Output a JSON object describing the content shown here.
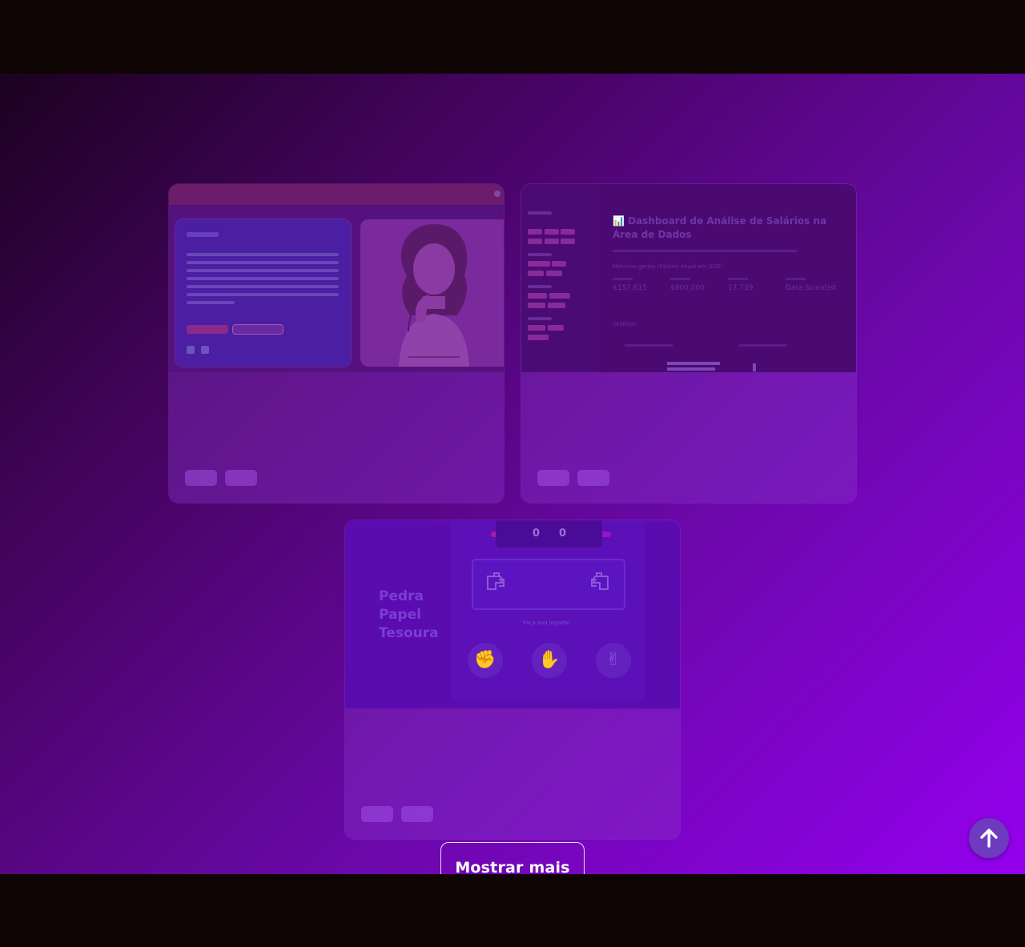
{
  "projects": [
    {
      "id_hint": "portfolio",
      "thumb_colors": {
        "accent": "#8a2a8a"
      }
    },
    {
      "id_hint": "dashboard",
      "thumb_title": "📊 Dashboard de Análise de Salários na Área de Dados",
      "thumb_metric_title": "Métricas gerais (Salário anual em USD)",
      "thumb_metrics": [
        "$157,615",
        "$800,000",
        "17,739",
        "Data Scientist"
      ],
      "thumb_section": "Gráficos"
    },
    {
      "id_hint": "game",
      "thumb_title_lines": [
        "Pedra",
        "Papel",
        "Tesoura"
      ],
      "thumb_score_player": "0",
      "thumb_score_cpu": "0",
      "thumb_hint": "Faça sua jogada!",
      "thumb_choices": [
        "rock-icon",
        "paper-icon",
        "scissors-icon"
      ]
    }
  ],
  "show_more_label": "Mostrar mais",
  "back_to_top_icon": "arrow-up-icon",
  "colors": {
    "bg_dark": "#0e0404",
    "gradient_start": "#1c0220",
    "gradient_end": "#9400ee",
    "to_top": "#6e3ac0"
  }
}
